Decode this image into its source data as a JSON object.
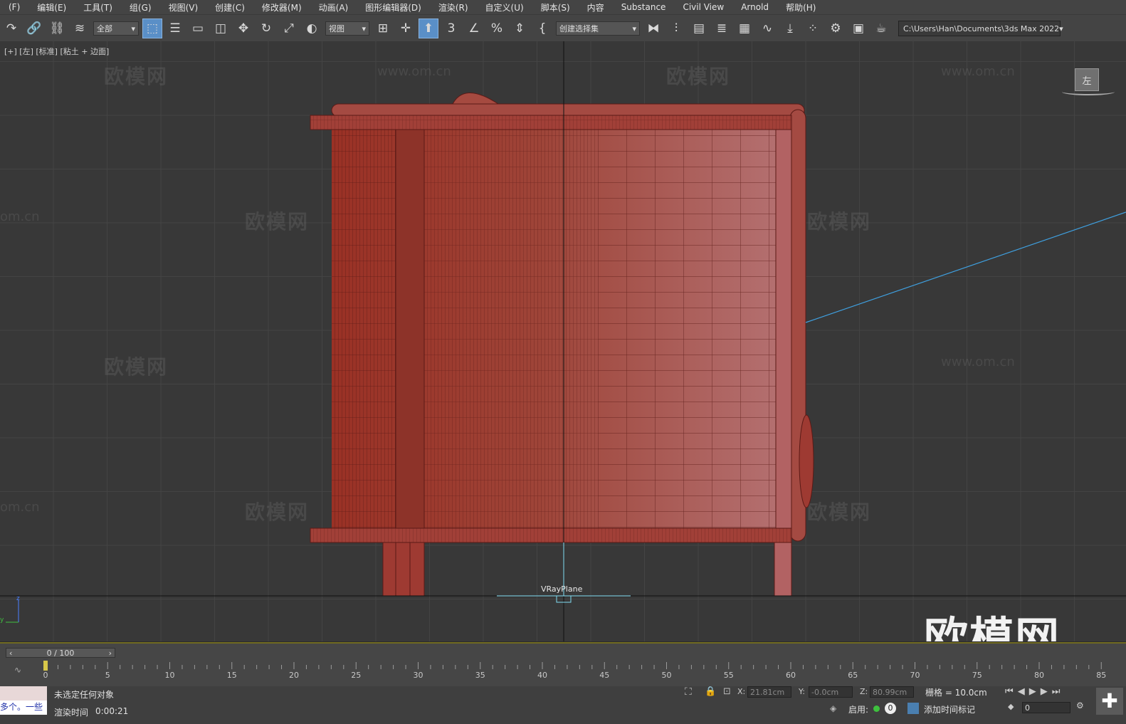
{
  "menu": {
    "items": [
      "(F)",
      "编辑(E)",
      "工具(T)",
      "组(G)",
      "视图(V)",
      "创建(C)",
      "修改器(M)",
      "动画(A)",
      "图形编辑器(D)",
      "渲染(R)",
      "自定义(U)",
      "脚本(S)",
      "内容",
      "Substance",
      "Civil View",
      "Arnold",
      "帮助(H)"
    ]
  },
  "toolbar": {
    "selection_filter": "全部",
    "reference_coord": "视图",
    "named_selection": "创建选择集",
    "snap_label": "3",
    "project_path": "C:\\Users\\Han\\Documents\\3ds Max 2022"
  },
  "viewport": {
    "label": "[+] [左] [标准] [粘土 + 边面]",
    "viewcube_face": "左",
    "object_label": "VRayPlane",
    "watermark_text": "欧模网",
    "watermark_url": "www.om.cn",
    "watermark_url_partial": "om.cn",
    "logo_text": "欧模网",
    "axis_z": "z",
    "axis_y": "y",
    "colors": {
      "model": "#a44a42",
      "model_dark": "#8d3329",
      "grid": "#444444",
      "bg": "#383838",
      "light_line": "#3fa0e0"
    }
  },
  "timeline": {
    "frame_display": "0 / 100",
    "ticks": [
      "0",
      "5",
      "10",
      "15",
      "20",
      "25",
      "30",
      "35",
      "40",
      "45",
      "50",
      "55",
      "60",
      "65",
      "70",
      "75",
      "80",
      "85"
    ]
  },
  "status": {
    "selection": "未选定任何对象",
    "render_time_label": "渲染时间",
    "render_time": "0:00:21",
    "maxscript_text": "多个。一些",
    "x_label": "X:",
    "x_value": "21.81cm",
    "y_label": "Y:",
    "y_value": "-0.0cm",
    "z_label": "Z:",
    "z_value": "80.99cm",
    "grid_label": "栅格 = 10.0cm",
    "enable_label": "启用:",
    "enable_count": "0",
    "add_time_tag": "添加时间标记",
    "frame_input": "0"
  }
}
